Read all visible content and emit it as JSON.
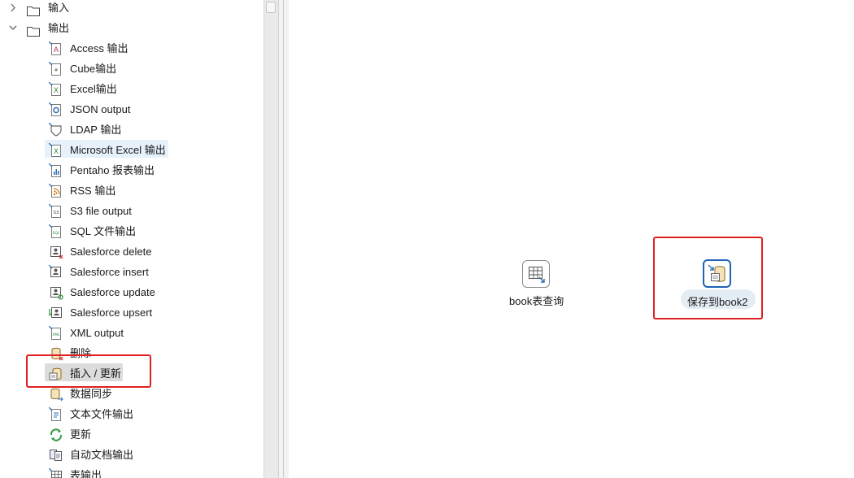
{
  "tree": {
    "categories": [
      {
        "label": "输入",
        "state": "collapsed"
      },
      {
        "label": "输出",
        "state": "expanded"
      }
    ],
    "items": [
      {
        "label": "Access 输出",
        "icon": "access-icon"
      },
      {
        "label": "Cube输出",
        "icon": "cube-icon"
      },
      {
        "label": "Excel输出",
        "icon": "excel-icon"
      },
      {
        "label": "JSON output",
        "icon": "json-icon"
      },
      {
        "label": "LDAP 输出",
        "icon": "ldap-icon"
      },
      {
        "label": "Microsoft Excel 输出",
        "icon": "excel-icon"
      },
      {
        "label": "Pentaho 报表输出",
        "icon": "report-icon"
      },
      {
        "label": "RSS 输出",
        "icon": "rss-icon"
      },
      {
        "label": "S3 file output",
        "icon": "s3-icon"
      },
      {
        "label": "SQL 文件输出",
        "icon": "sql-file-icon"
      },
      {
        "label": "Salesforce delete",
        "icon": "salesforce-delete-icon"
      },
      {
        "label": "Salesforce insert",
        "icon": "salesforce-insert-icon"
      },
      {
        "label": "Salesforce update",
        "icon": "salesforce-update-icon"
      },
      {
        "label": "Salesforce upsert",
        "icon": "salesforce-upsert-icon"
      },
      {
        "label": "XML output",
        "icon": "xml-icon"
      },
      {
        "label": "删除",
        "icon": "delete-db-icon"
      },
      {
        "label": "插入 / 更新",
        "icon": "insert-update-icon"
      },
      {
        "label": "数据同步",
        "icon": "sync-db-icon"
      },
      {
        "label": "文本文件输出",
        "icon": "text-file-icon"
      },
      {
        "label": "更新",
        "icon": "update-refresh-icon"
      },
      {
        "label": "自动文档输出",
        "icon": "autodoc-icon"
      },
      {
        "label": "表输出",
        "icon": "table-output-icon"
      }
    ]
  },
  "canvas": {
    "steps": [
      {
        "label": "book表查询",
        "icon": "table-input-icon"
      },
      {
        "label": "保存到book2",
        "icon": "insert-update-icon",
        "selected": true
      }
    ]
  },
  "colors": {
    "annotation_red": "#e02020",
    "hover_blue": "#e6f1fb",
    "selected_gray": "#dcdcdc",
    "step_selected_border": "#1e64b4"
  }
}
